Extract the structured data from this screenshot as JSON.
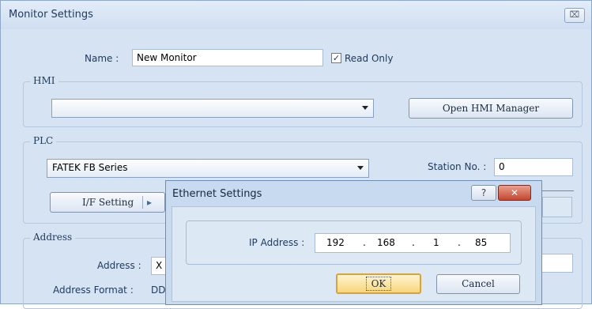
{
  "window": {
    "title": "Monitor Settings",
    "close_glyph": "⌧"
  },
  "name": {
    "label": "Name :",
    "value": "New Monitor"
  },
  "read_only": {
    "label": "Read Only",
    "checked": true
  },
  "hmi": {
    "group_label": "HMI",
    "selected": "",
    "open_manager_label": "Open HMI Manager"
  },
  "plc": {
    "group_label": "PLC",
    "selected": "FATEK FB Series",
    "station_label": "Station No. :",
    "station_value": "0",
    "if_setting_label": "I/F Setting",
    "if_arrow": "▸"
  },
  "address": {
    "group_label": "Address",
    "address_label": "Address :",
    "address_value": "X",
    "format_label": "Address Format :",
    "format_value": "DD"
  },
  "ethernet_dialog": {
    "title": "Ethernet Settings",
    "help_glyph": "?",
    "close_glyph": "✕",
    "ip_label": "IP Address :",
    "ip": [
      "192",
      "168",
      "1",
      "85"
    ],
    "dot": ".",
    "ok_label": "OK",
    "cancel_label": "Cancel"
  }
}
